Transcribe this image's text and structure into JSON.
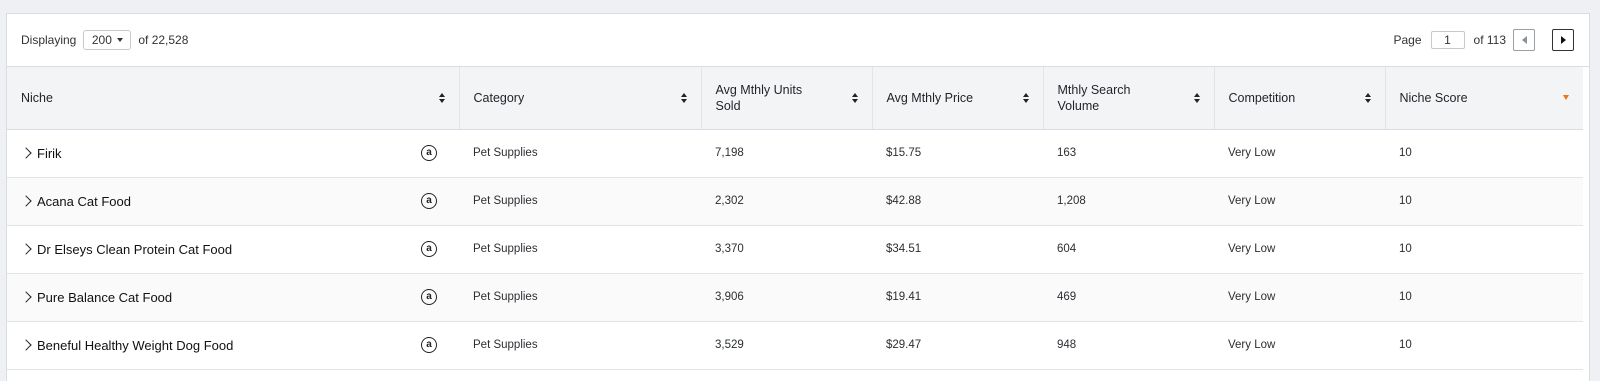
{
  "toolbar": {
    "displaying_label": "Displaying",
    "page_size": "200",
    "of_total": "of 22,528",
    "page_label": "Page",
    "page_value": "1",
    "of_pages": "of 113"
  },
  "columns": [
    {
      "label": "Niche",
      "sorted": false
    },
    {
      "label": "Category",
      "sorted": false
    },
    {
      "label": "Avg Mthly Units Sold",
      "sorted": false
    },
    {
      "label": "Avg Mthly Price",
      "sorted": false
    },
    {
      "label": "Mthly Search Volume",
      "sorted": false
    },
    {
      "label": "Competition",
      "sorted": false
    },
    {
      "label": "Niche Score",
      "sorted": true,
      "direction": "desc"
    }
  ],
  "rows": [
    {
      "niche": "Firik",
      "category": "Pet Supplies",
      "units": "7,198",
      "price": "$15.75",
      "search": "163",
      "competition": "Very Low",
      "score": "10"
    },
    {
      "niche": "Acana Cat Food",
      "category": "Pet Supplies",
      "units": "2,302",
      "price": "$42.88",
      "search": "1,208",
      "competition": "Very Low",
      "score": "10"
    },
    {
      "niche": "Dr Elseys Clean Protein Cat Food",
      "category": "Pet Supplies",
      "units": "3,370",
      "price": "$34.51",
      "search": "604",
      "competition": "Very Low",
      "score": "10"
    },
    {
      "niche": "Pure Balance Cat Food",
      "category": "Pet Supplies",
      "units": "3,906",
      "price": "$19.41",
      "search": "469",
      "competition": "Very Low",
      "score": "10"
    },
    {
      "niche": "Beneful Healthy Weight Dog Food",
      "category": "Pet Supplies",
      "units": "3,529",
      "price": "$29.47",
      "search": "948",
      "competition": "Very Low",
      "score": "10"
    }
  ],
  "icons": {
    "expand": "chevron-right-icon",
    "amazon": "amazon-icon",
    "sort": "sort-icon",
    "prev": "prev-page-icon",
    "next": "next-page-icon"
  },
  "colors": {
    "active_sort": "#e8761a",
    "header_bg": "#f3f4f6"
  }
}
